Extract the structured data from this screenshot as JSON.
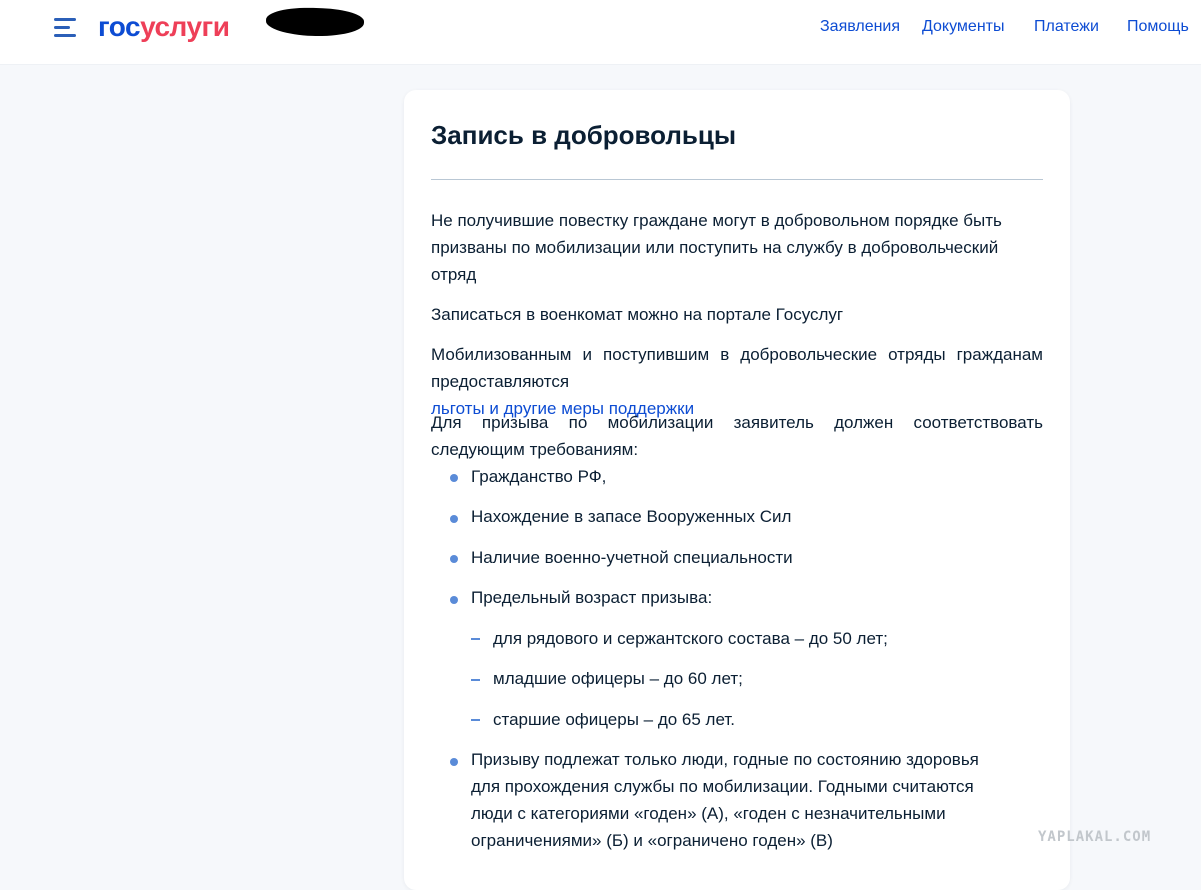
{
  "header": {
    "logo_part1": "гос",
    "logo_part2": "услуги",
    "nav": [
      "Заявления",
      "Документы",
      "Платежи",
      "Помощь"
    ]
  },
  "card": {
    "title": "Запись в добровольцы",
    "p1": "Не получившие повестку граждане могут в добровольном порядке быть призваны по мобилизации или поступить на службу в добровольческий отряд",
    "p2": "Записаться в военкомат можно на портале Госуслуг",
    "p3_text": "Мобилизованным и поступившим в добровольческие отряды гражданам предоставляются",
    "p3_link": "льготы и другие меры поддержки",
    "p4": "Для призыва по мобилизации заявитель должен соответствовать следующим требованиям:",
    "requirements": [
      "Гражданство РФ,",
      "Нахождение в запасе Вооруженных Сил",
      "Наличие военно-учетной специальности",
      "Предельный возраст призыва:"
    ],
    "age_limits": [
      "для рядового и сержантского состава – до 50 лет;",
      "младшие офицеры – до 60 лет;",
      "старшие офицеры – до 65 лет."
    ],
    "health_lines": [
      "Призыву подлежат только люди, годные по состоянию здоровья",
      "для прохождения службы по мобилизации. Годными считаются",
      "люди с категориями «годен» (А), «годен с незначительными",
      "ограничениями» (Б) и «ограничено годен» (В)"
    ]
  },
  "watermark": "YAPLAKAL.COM",
  "colors": {
    "brand_blue": "#0d4cd3",
    "brand_red": "#ee3f58",
    "text": "#0b1f33",
    "bullet": "#5a8bd8",
    "background": "#f6f8fb"
  }
}
